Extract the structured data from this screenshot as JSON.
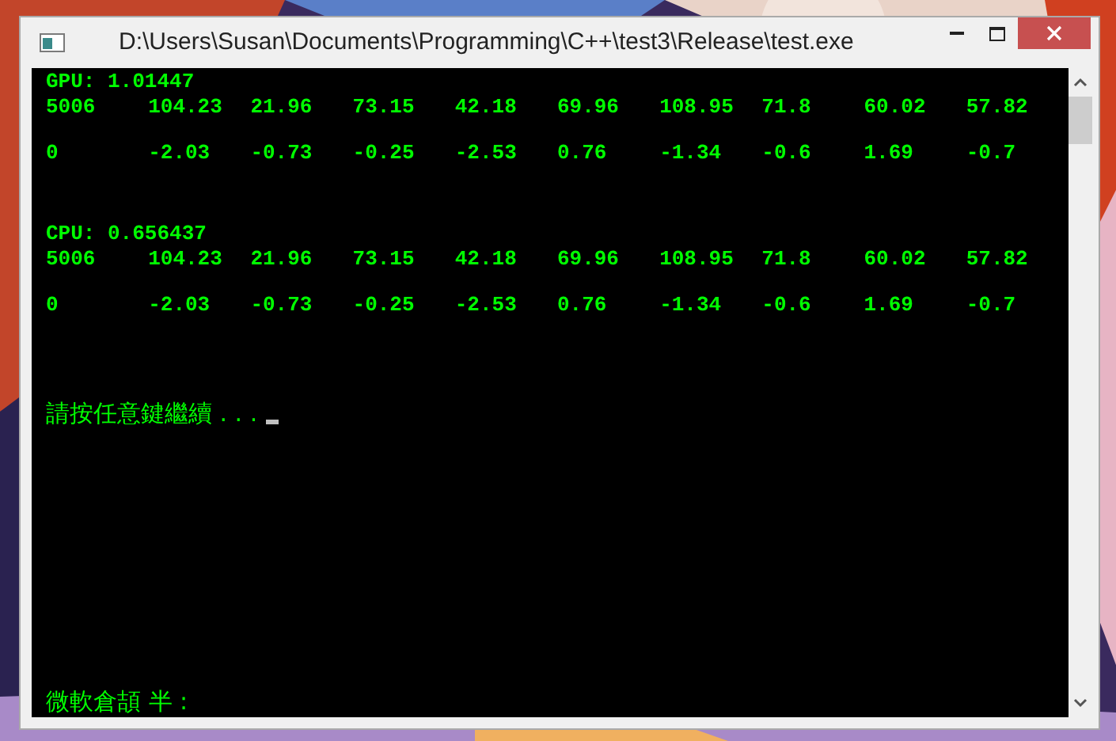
{
  "window": {
    "title": "D:\\Users\\Susan\\Documents\\Programming\\C++\\test3\\Release\\test.exe"
  },
  "console": {
    "sections": [
      {
        "label": "GPU: 1.01447",
        "rows": [
          [
            "5006",
            "104.23",
            "21.96",
            "73.15",
            "42.18",
            "69.96",
            "108.95",
            "71.8",
            "60.02",
            "57.82"
          ],
          [
            "0",
            "-2.03",
            "-0.73",
            "-0.25",
            "-2.53",
            "0.76",
            "-1.34",
            "-0.6",
            "1.69",
            "-0.7"
          ]
        ]
      },
      {
        "label": "CPU: 0.656437",
        "rows": [
          [
            "5006",
            "104.23",
            "21.96",
            "73.15",
            "42.18",
            "69.96",
            "108.95",
            "71.8",
            "60.02",
            "57.82"
          ],
          [
            "0",
            "-2.03",
            "-0.73",
            "-0.25",
            "-2.53",
            "0.76",
            "-1.34",
            "-0.6",
            "1.69",
            "-0.7"
          ]
        ]
      }
    ],
    "prompt": "請按任意鍵繼續 . . .",
    "ime_status": "微軟倉頡 半 :"
  }
}
